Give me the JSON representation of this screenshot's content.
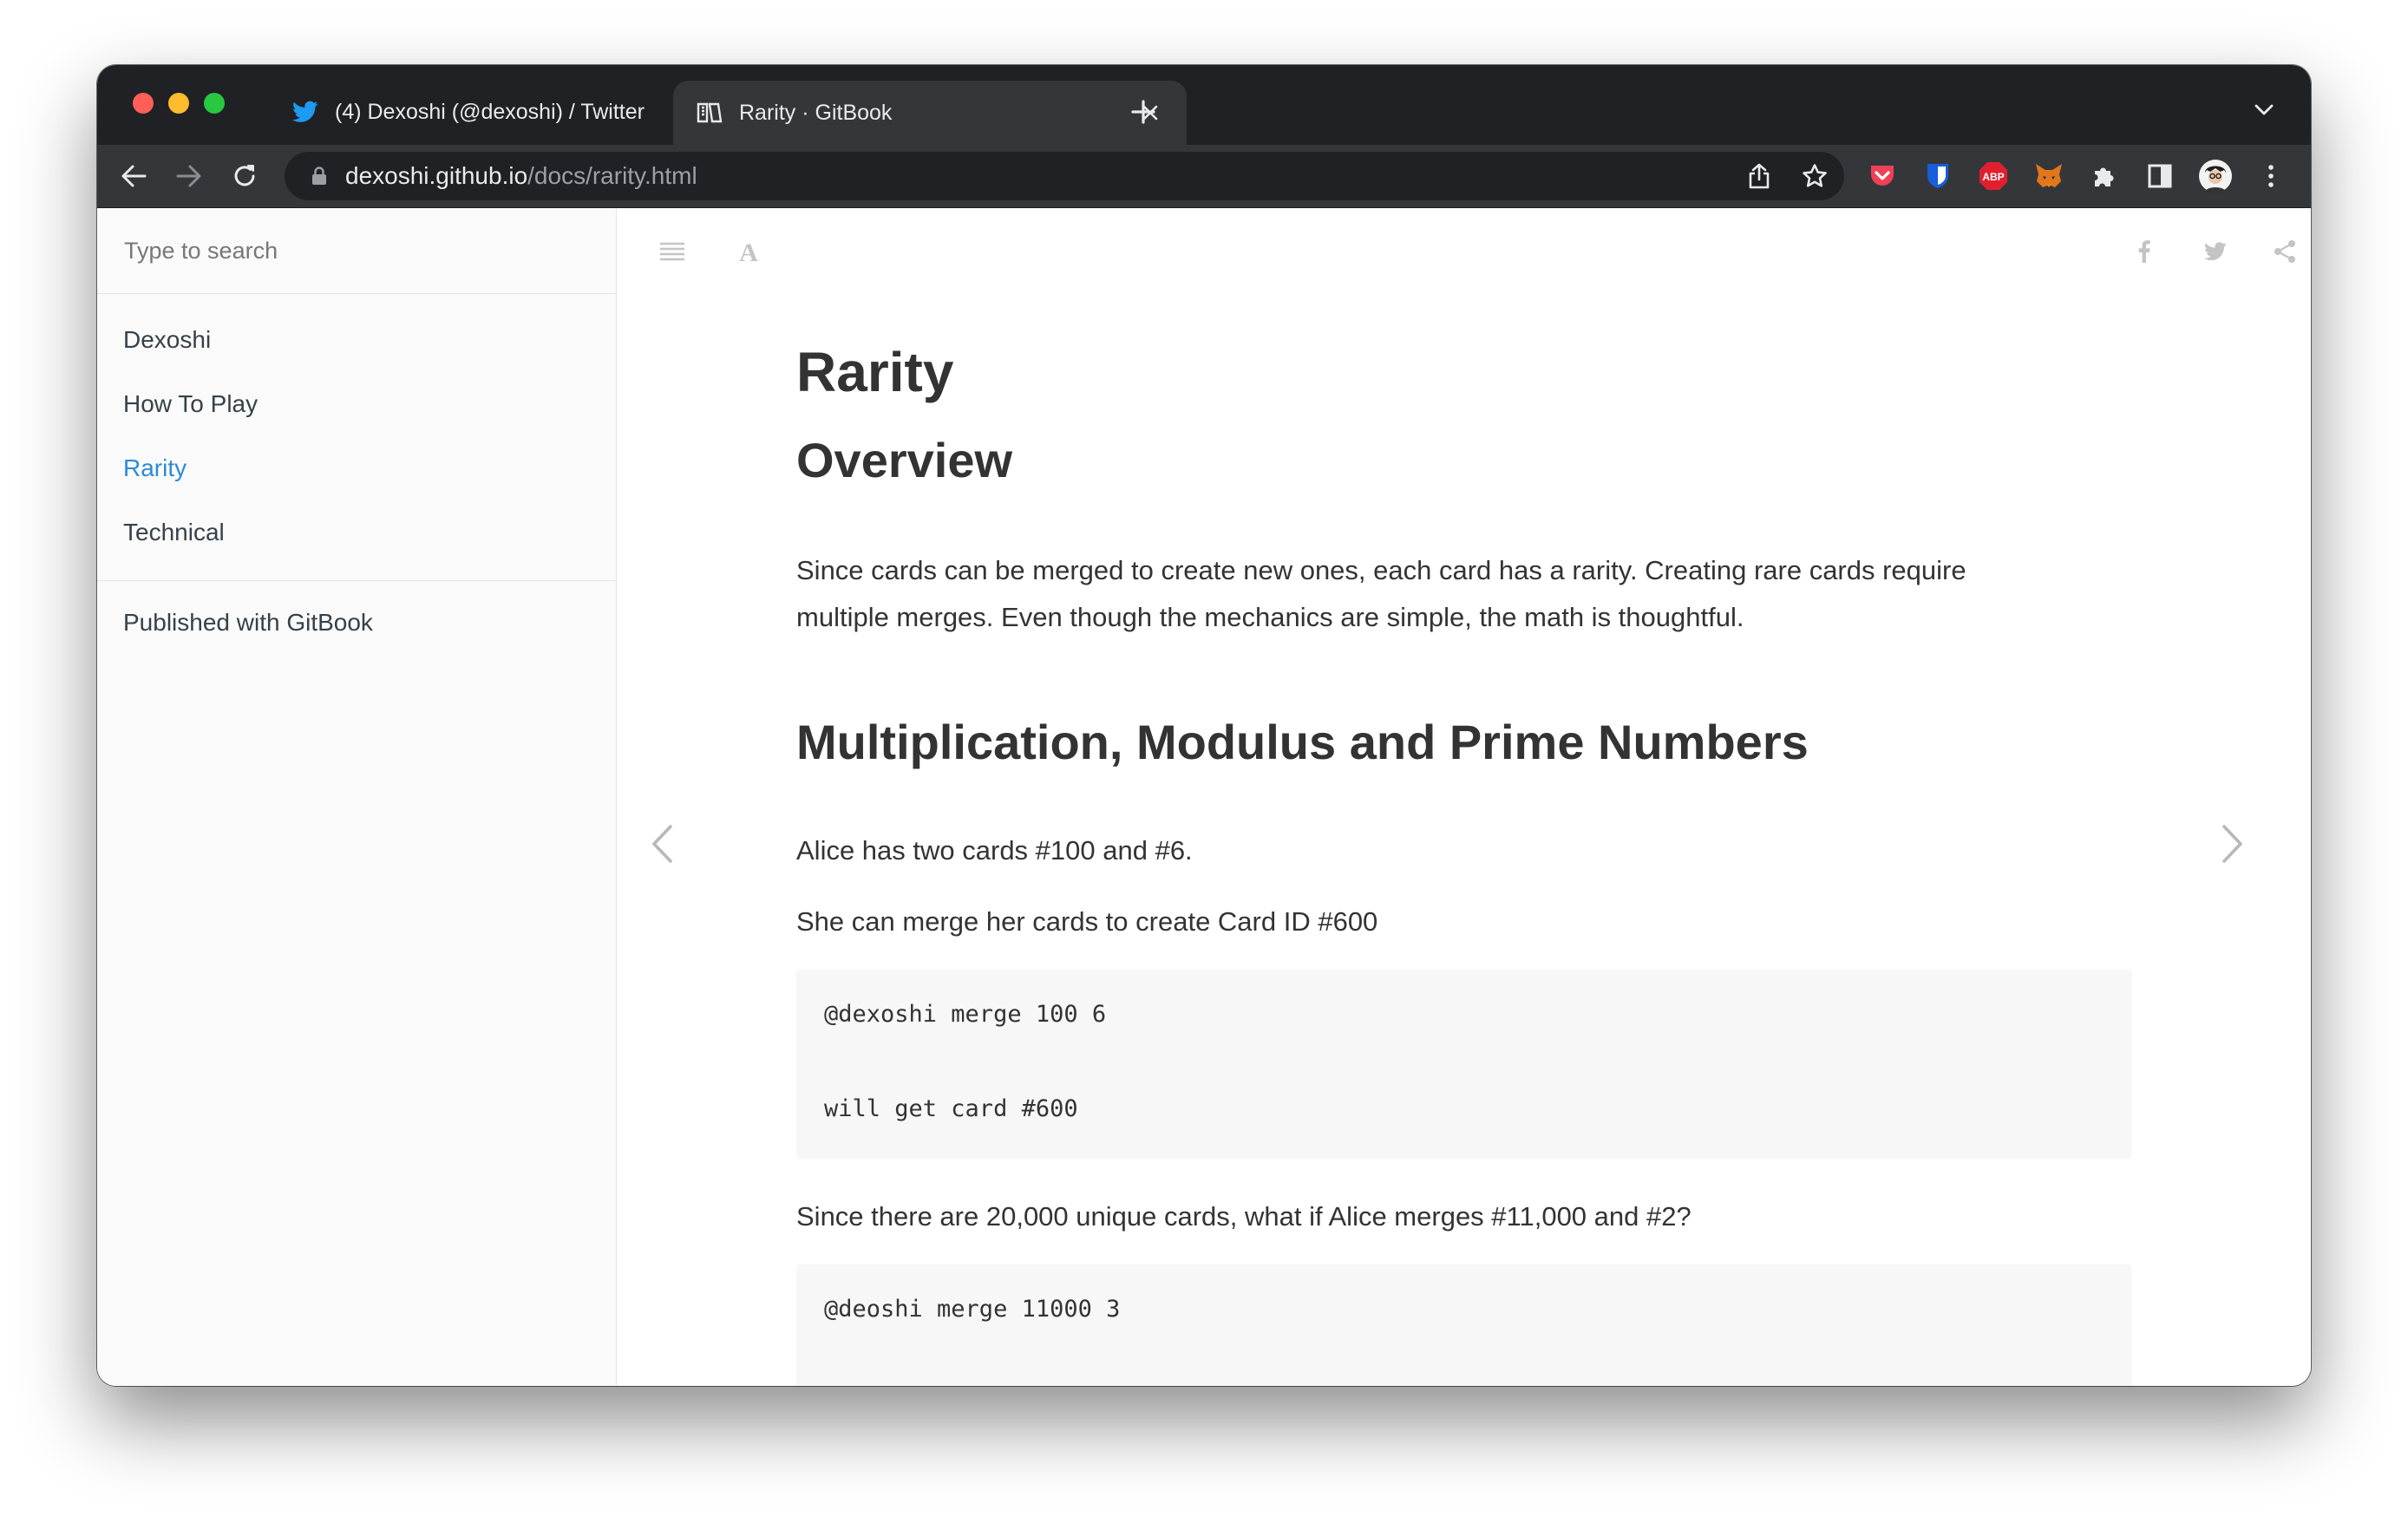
{
  "browser": {
    "tabs": [
      {
        "title": "(4) Dexoshi (@dexoshi) / Twitter",
        "favicon": "twitter-bird-icon",
        "active": false
      },
      {
        "title": "Rarity · GitBook",
        "favicon": "gitbook-icon",
        "active": true
      }
    ],
    "url_host": "dexoshi.github.io",
    "url_path": "/docs/rarity.html",
    "extensions": [
      "pocket-icon",
      "bitwarden-icon",
      "adblock-plus-icon",
      "metamask-fox-icon",
      "puzzle-extensions-icon",
      "sidepanel-icon",
      "profile-avatar"
    ],
    "colors": {
      "tabstrip": "#202124",
      "toolbar": "#35363a",
      "omnibox": "#202124"
    }
  },
  "sidebar": {
    "search_placeholder": "Type to search",
    "items": [
      {
        "label": "Dexoshi",
        "active": false
      },
      {
        "label": "How To Play",
        "active": false
      },
      {
        "label": "Rarity",
        "active": true
      },
      {
        "label": "Technical",
        "active": false
      }
    ],
    "published": "Published with GitBook",
    "accent": "#2b8bd8"
  },
  "book_header": {
    "left_icons": [
      "toc-lines-icon",
      "font-settings-icon"
    ],
    "right_icons": [
      "twitter-share-icon",
      "facebook-share-icon",
      "share-icon"
    ]
  },
  "page": {
    "title": "Rarity",
    "h_overview": "Overview",
    "p_overview_1": "Since cards can be merged to create new ones, each card has a rarity. Creating rare cards require",
    "p_overview_2": "multiple merges. Even though the mechanics are simple, the math is thoughtful.",
    "h_mult": "Multiplication, Modulus and Prime Numbers",
    "p_alice": "Alice has two cards #100 and #6.",
    "p_merge": "She can merge her cards to create Card ID #600",
    "code1_line1": "@dexoshi merge 100 6",
    "code1_line2": "will get card #600",
    "p_unique": "Since there are 20,000 unique cards, what if Alice merges #11,000 and #2?",
    "code2_line1": "@deoshi merge 11000 3"
  }
}
